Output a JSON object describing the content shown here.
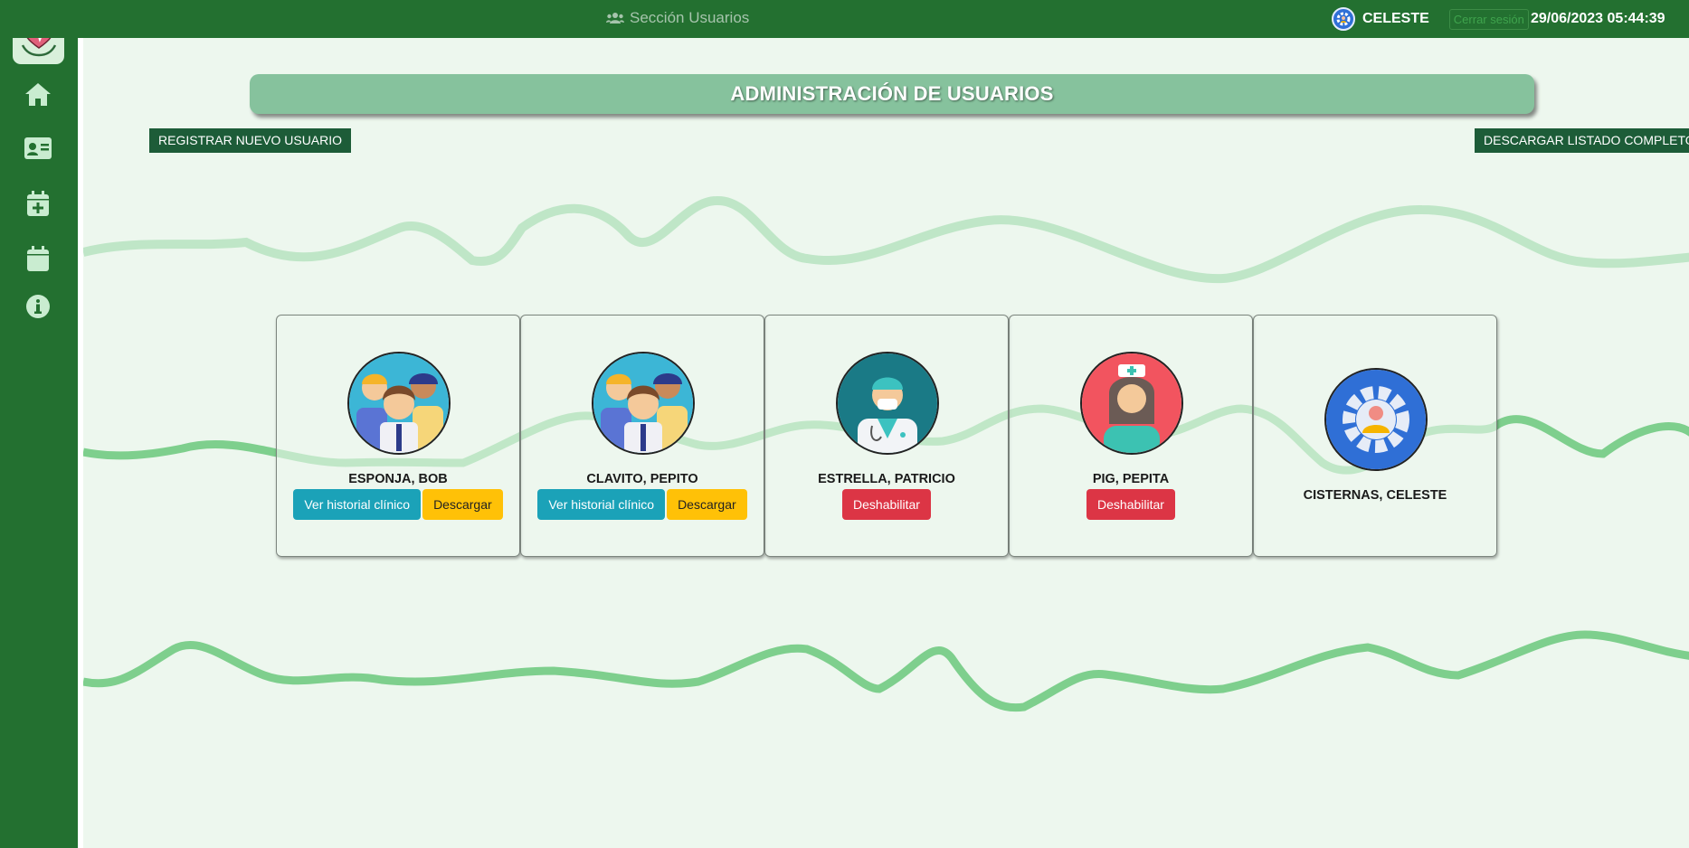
{
  "topbar": {
    "section_title": "Sección Usuarios",
    "section_icon": "users-icon",
    "user_name": "CELESTE",
    "logout_label": "Cerrar sesión",
    "datetime": "29/06/2023 05:44:39"
  },
  "sidebar": {
    "logo_icon": "heart-hands-icon",
    "items": [
      {
        "icon": "home-icon"
      },
      {
        "icon": "id-card-icon"
      },
      {
        "icon": "calendar-plus-icon"
      },
      {
        "icon": "calendar-icon"
      },
      {
        "icon": "info-icon"
      }
    ]
  },
  "main": {
    "title": "ADMINISTRACIÓN DE USUARIOS",
    "register_label": "REGISTRAR NUEVO USUARIO",
    "download_all_label": "DESCARGAR LISTADO COMPLETO",
    "users": [
      {
        "name": "ESPONJA, BOB",
        "avatar": "patients-group-avatar",
        "buttons": [
          "Ver historial clínico",
          "Descargar"
        ]
      },
      {
        "name": "CLAVITO, PEPITO",
        "avatar": "patients-group-avatar",
        "buttons": [
          "Ver historial clínico",
          "Descargar"
        ]
      },
      {
        "name": "ESTRELLA, PATRICIO",
        "avatar": "doctor-avatar",
        "buttons": [
          "Deshabilitar"
        ]
      },
      {
        "name": "PIG, PEPITA",
        "avatar": "nurse-avatar",
        "buttons": [
          "Deshabilitar"
        ]
      },
      {
        "name": "CISTERNAS, CELESTE",
        "avatar": "admin-gear-avatar",
        "buttons": []
      }
    ]
  },
  "colors": {
    "sidebar": "#237030",
    "background": "#edf7ee",
    "banner": "#86c29d",
    "dark_button": "#1d5c38",
    "info": "#1ba2b8",
    "warning": "#ffc107",
    "danger": "#dc3545"
  }
}
